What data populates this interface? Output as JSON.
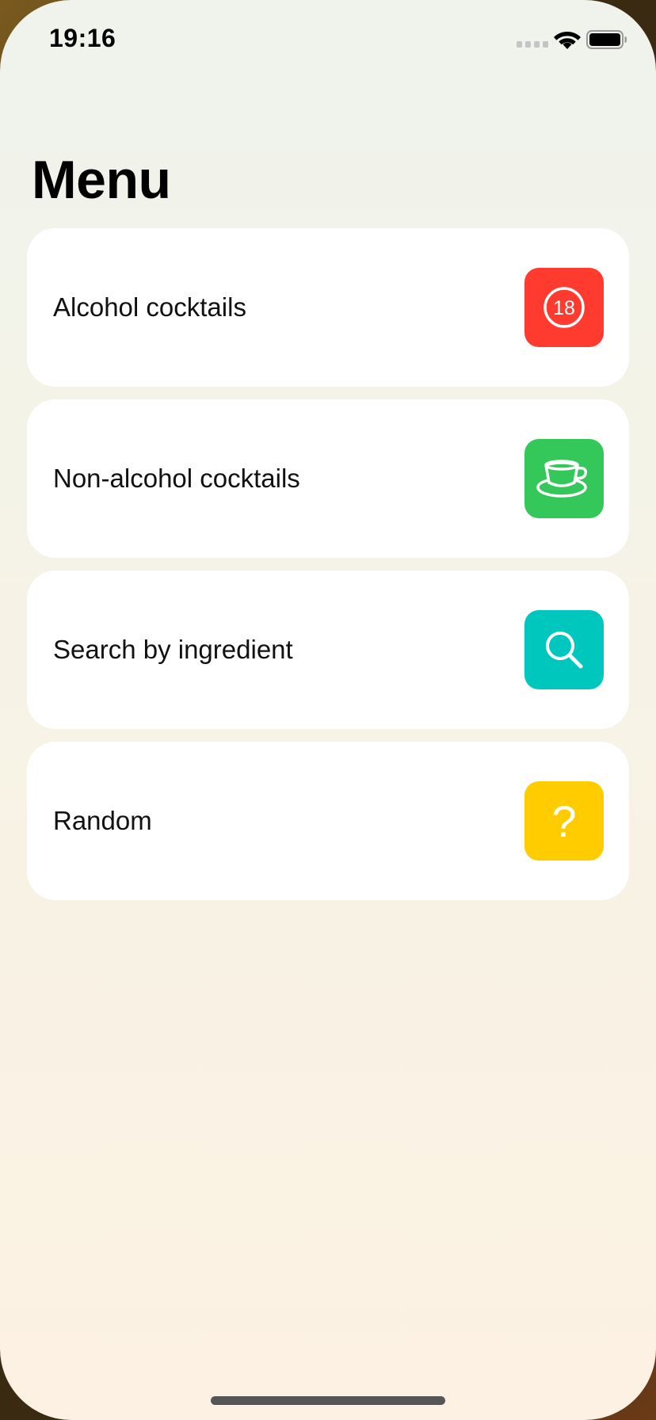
{
  "status_bar": {
    "time": "19:16",
    "icons": [
      "cellular-signal-icon",
      "wifi-icon",
      "battery-icon"
    ]
  },
  "page": {
    "title": "Menu"
  },
  "menu": {
    "items": [
      {
        "label": "Alcohol cocktails",
        "icon": "age-18-icon",
        "icon_text": "18",
        "color": "#FF3B30"
      },
      {
        "label": "Non-alcohol cocktails",
        "icon": "cup-and-saucer-icon",
        "color": "#34C759"
      },
      {
        "label": "Search by ingredient",
        "icon": "magnifying-glass-icon",
        "color": "#00C7BE"
      },
      {
        "label": "Random",
        "icon": "question-mark-icon",
        "icon_text": "?",
        "color": "#FFCC00"
      }
    ]
  }
}
